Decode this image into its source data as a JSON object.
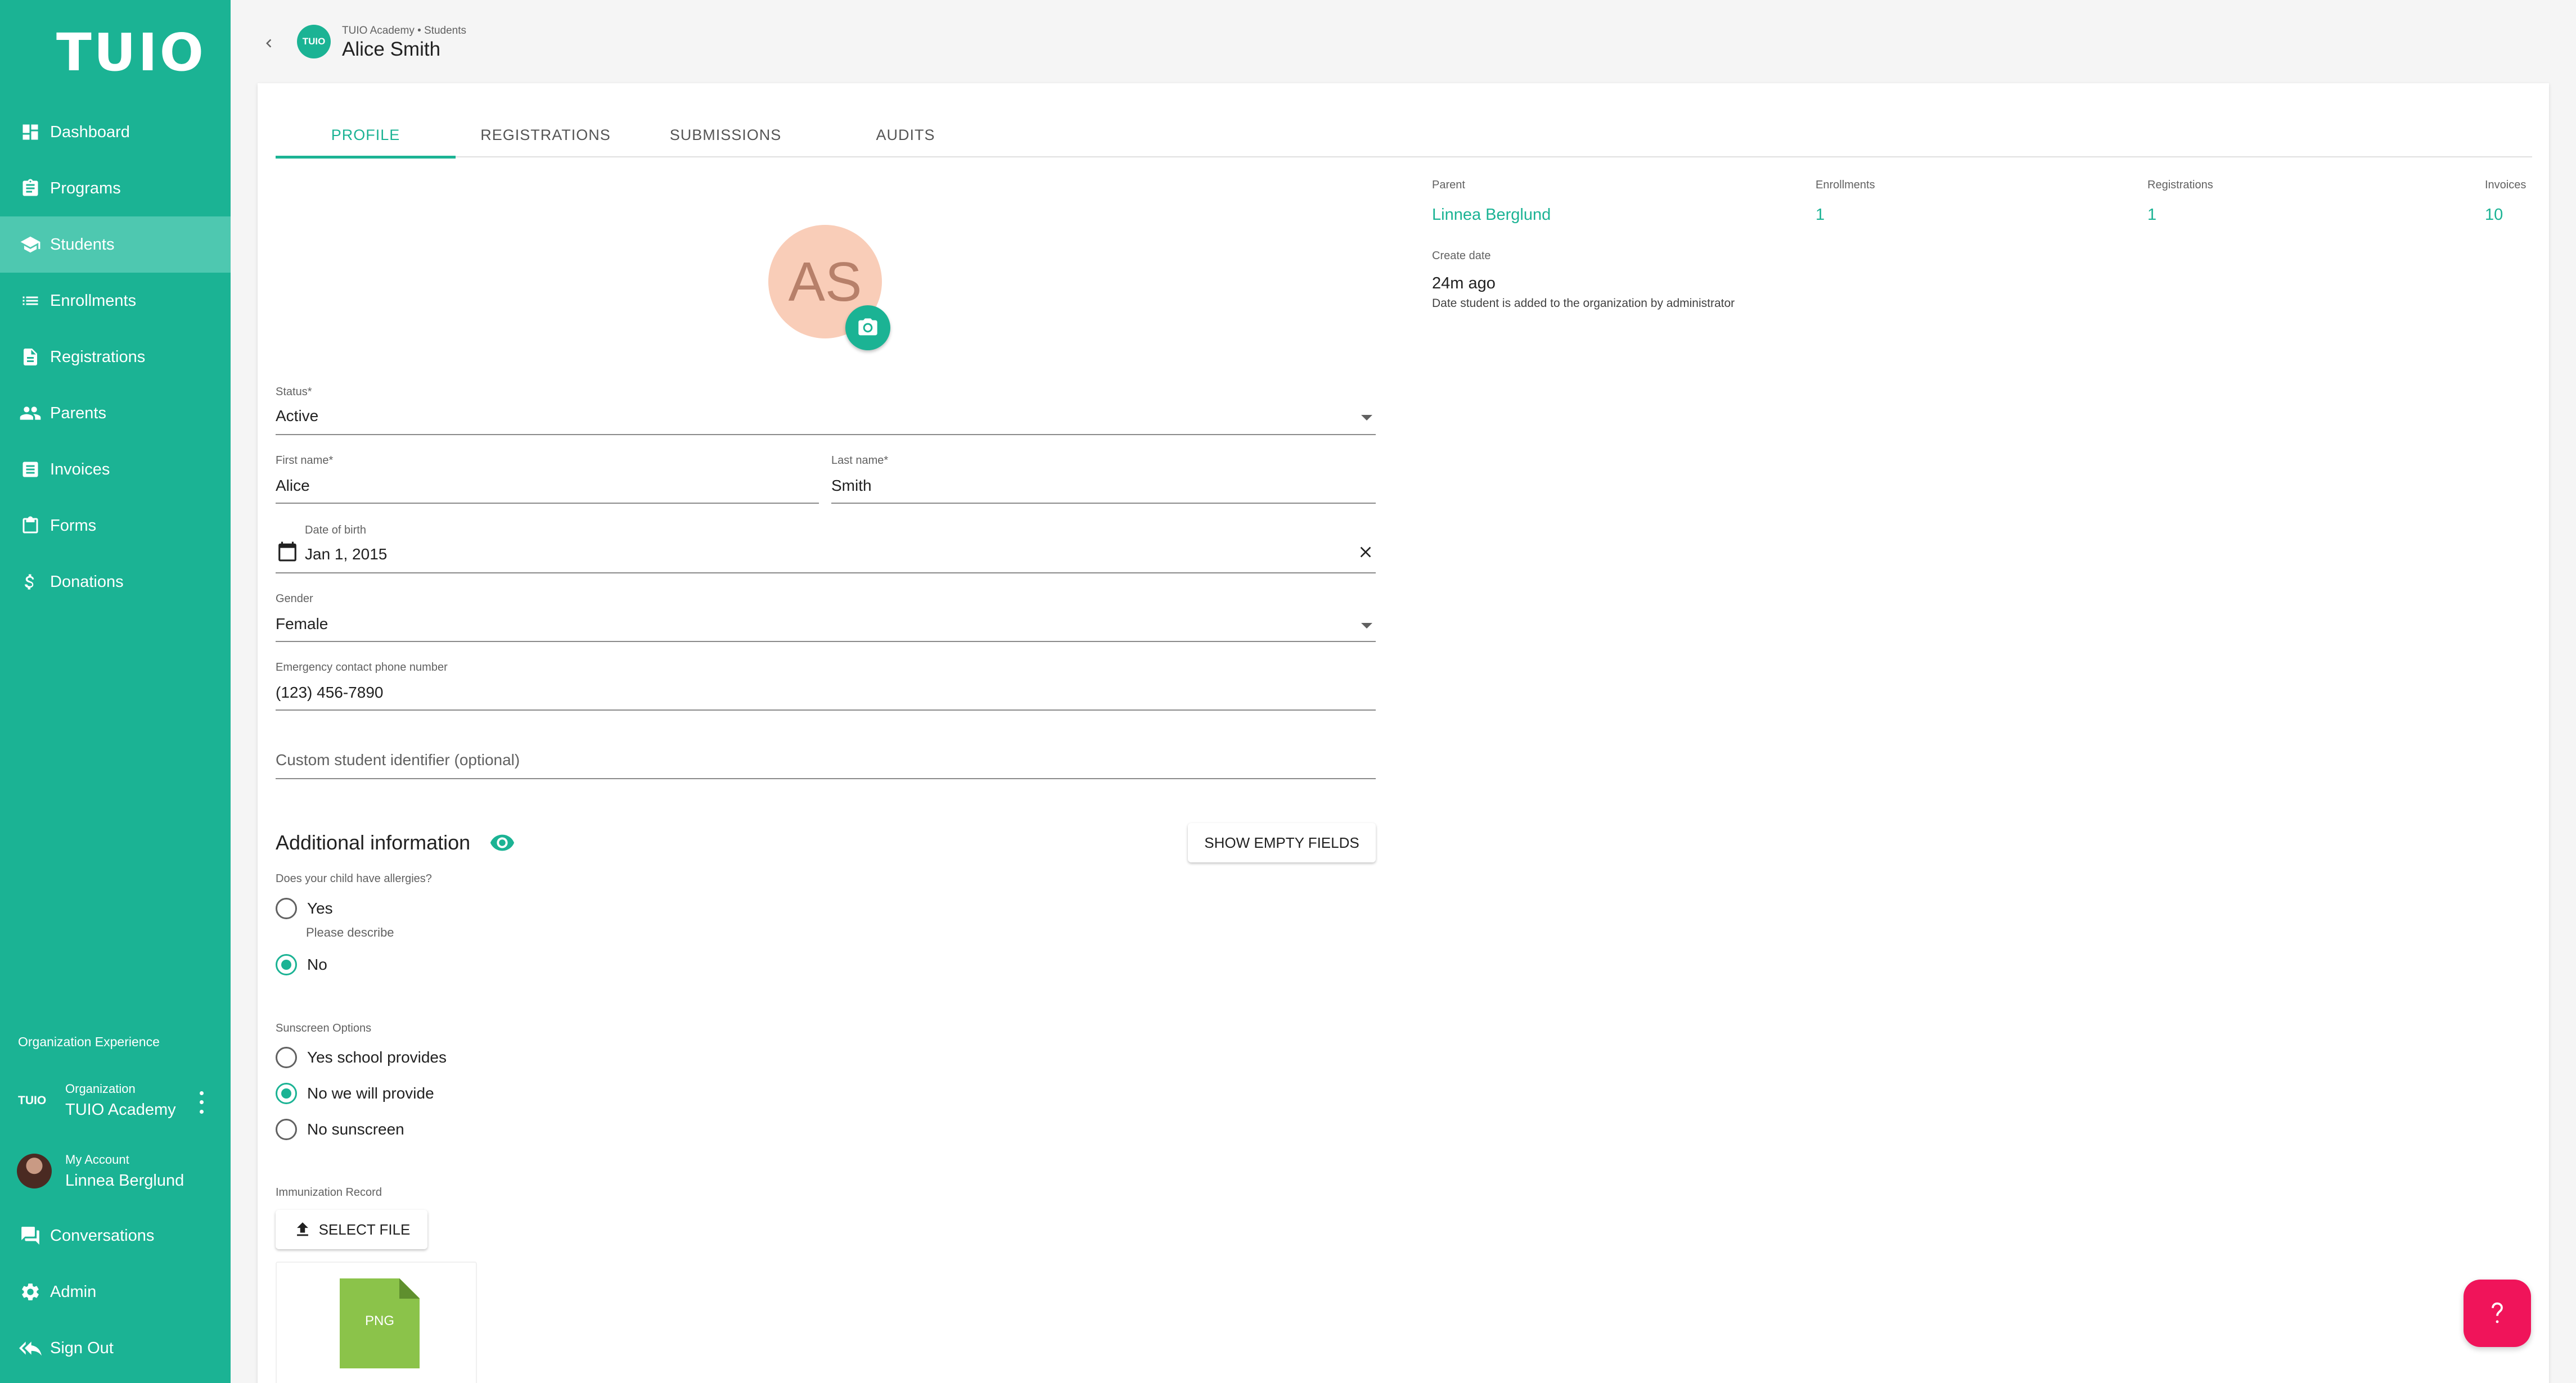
{
  "sidebar": {
    "logo": "TUIO",
    "items": [
      {
        "label": "Dashboard",
        "icon": "dashboard-icon"
      },
      {
        "label": "Programs",
        "icon": "clipboard-icon"
      },
      {
        "label": "Students",
        "icon": "school-icon"
      },
      {
        "label": "Enrollments",
        "icon": "list-icon"
      },
      {
        "label": "Registrations",
        "icon": "document-icon"
      },
      {
        "label": "Parents",
        "icon": "people-icon"
      },
      {
        "label": "Invoices",
        "icon": "receipt-icon"
      },
      {
        "label": "Forms",
        "icon": "form-icon"
      },
      {
        "label": "Donations",
        "icon": "dollar-icon"
      }
    ],
    "org_heading": "Organization Experience",
    "organization": {
      "badge": "TUIO",
      "sub": "Organization",
      "name": "TUIO Academy"
    },
    "account": {
      "sub": "My Account",
      "name": "Linnea Berglund"
    },
    "bottom": [
      {
        "label": "Conversations",
        "icon": "chat-icon"
      },
      {
        "label": "Admin",
        "icon": "gear-icon"
      },
      {
        "label": "Sign Out",
        "icon": "sign-out-icon"
      }
    ]
  },
  "header": {
    "org_logo_text": "TUIO",
    "breadcrumb": "TUIO Academy • Students",
    "title": "Alice Smith"
  },
  "tabs": [
    {
      "label": "PROFILE",
      "active": true
    },
    {
      "label": "REGISTRATIONS",
      "active": false
    },
    {
      "label": "SUBMISSIONS",
      "active": false
    },
    {
      "label": "AUDITS",
      "active": false
    }
  ],
  "profile": {
    "initials": "AS",
    "status": {
      "label": "Status*",
      "value": "Active"
    },
    "first_name": {
      "label": "First name*",
      "value": "Alice"
    },
    "last_name": {
      "label": "Last name*",
      "value": "Smith"
    },
    "dob": {
      "label": "Date of birth",
      "value": "Jan 1, 2015"
    },
    "gender": {
      "label": "Gender",
      "value": "Female"
    },
    "emergency": {
      "label": "Emergency contact phone number",
      "value": "(123) 456-7890"
    },
    "custom_id": {
      "placeholder": "Custom student identifier (optional)"
    }
  },
  "additional": {
    "title": "Additional information",
    "show_empty_label": "SHOW EMPTY FIELDS",
    "allergies": {
      "question": "Does your child have allergies?",
      "options": [
        "Yes",
        "No"
      ],
      "selected": "No",
      "helper": "Please describe"
    },
    "sunscreen": {
      "question": "Sunscreen Options",
      "options": [
        "Yes school provides",
        "No we will provide",
        "No sunscreen"
      ],
      "selected": "No we will provide"
    },
    "immunization": {
      "label": "Immunization Record",
      "select_label": "SELECT FILE",
      "file_type": "PNG"
    }
  },
  "info": {
    "parent": {
      "label": "Parent",
      "value": "Linnea Berglund"
    },
    "enrollments": {
      "label": "Enrollments",
      "value": "1"
    },
    "registrations": {
      "label": "Registrations",
      "value": "1"
    },
    "invoices": {
      "label": "Invoices",
      "value": "10"
    },
    "create_date": {
      "label": "Create date",
      "value": "24m ago",
      "help": "Date student is added to the organization by administrator"
    }
  },
  "colors": {
    "accent": "#1bb394",
    "help_button": "#f0145a",
    "avatar_bg": "#f9cdb8"
  }
}
